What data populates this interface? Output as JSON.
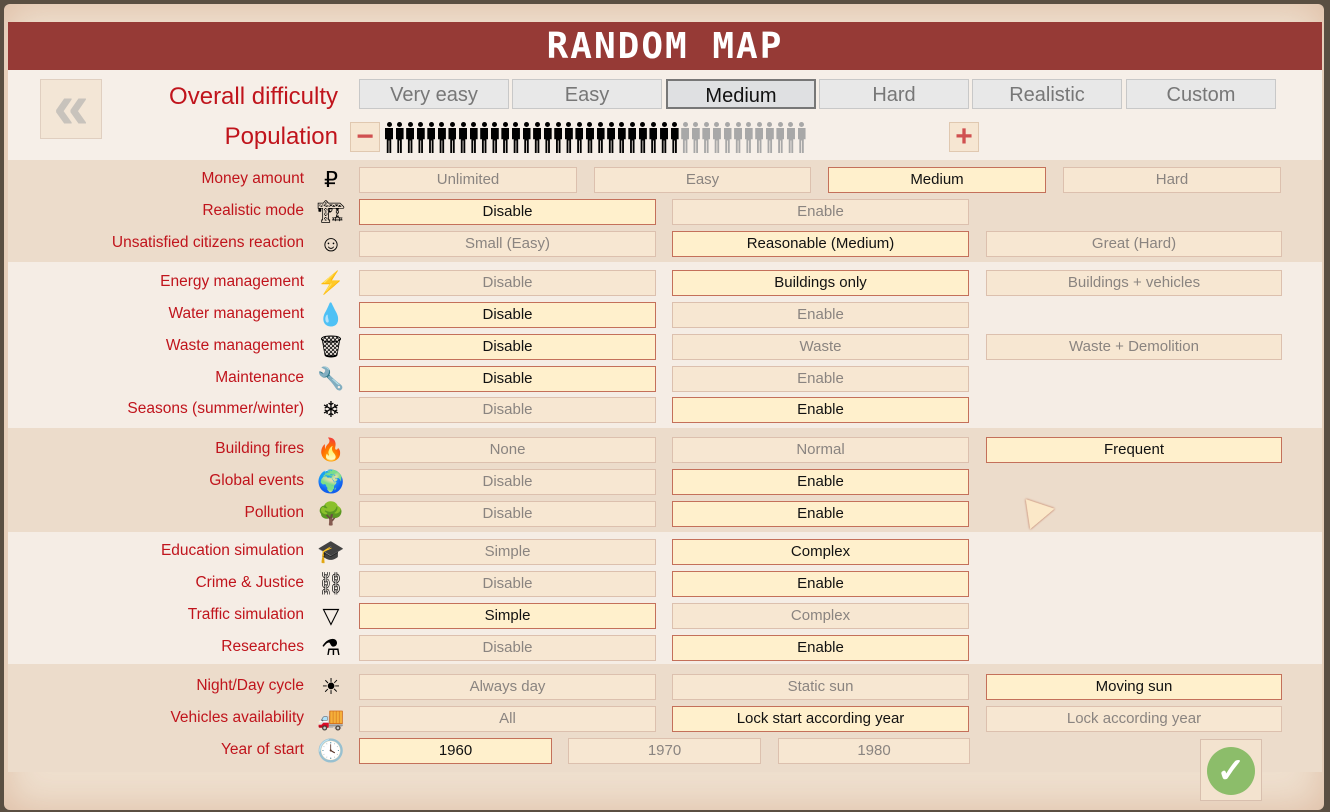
{
  "title": "RANDOM MAP",
  "overall_difficulty": {
    "label": "Overall difficulty",
    "options": [
      "Very easy",
      "Easy",
      "Medium",
      "Hard",
      "Realistic",
      "Custom"
    ],
    "selected": 2
  },
  "population": {
    "label": "Population",
    "level": 0.7,
    "total_figures": 40
  },
  "back_icon": "double-chevron-left-icon",
  "confirm_icon": "checkmark-icon",
  "colors": {
    "title_bar": "#963a36",
    "label": "#c0141c",
    "selected_bg": "#fff0cc",
    "selected_border": "#c4705a",
    "confirm": "#8cbd6a"
  },
  "sections": [
    {
      "rows": [
        {
          "label": "Money amount",
          "icon": "money-icon",
          "glyph": "₽",
          "layout": "four",
          "options": [
            "Unlimited",
            "Easy",
            "Medium",
            "Hard"
          ],
          "selected": 2
        },
        {
          "label": "Realistic mode",
          "icon": "crane-icon",
          "glyph": "🏗",
          "layout": "three",
          "options": [
            "Disable",
            "Enable"
          ],
          "selected": 0
        },
        {
          "label": "Unsatisfied citizens reaction",
          "icon": "smiley-icon",
          "glyph": "☺",
          "layout": "three",
          "options": [
            "Small (Easy)",
            "Reasonable (Medium)",
            "Great (Hard)"
          ],
          "selected": 1
        }
      ]
    },
    {
      "rows": [
        {
          "label": "Energy management",
          "icon": "lightning-icon",
          "glyph": "⚡",
          "layout": "three",
          "options": [
            "Disable",
            "Buildings only",
            "Buildings + vehicles"
          ],
          "selected": 1
        },
        {
          "label": "Water management",
          "icon": "water-drop-icon",
          "glyph": "💧",
          "layout": "three",
          "options": [
            "Disable",
            "Enable"
          ],
          "selected": 0
        },
        {
          "label": "Waste management",
          "icon": "dumpster-icon",
          "glyph": "🗑",
          "layout": "three",
          "options": [
            "Disable",
            "Waste",
            "Waste + Demolition"
          ],
          "selected": 0
        },
        {
          "label": "Maintenance",
          "icon": "wrench-icon",
          "glyph": "🔧",
          "layout": "three",
          "options": [
            "Disable",
            "Enable"
          ],
          "selected": 0
        },
        {
          "label": "Seasons (summer/winter)",
          "icon": "snowflake-icon",
          "glyph": "❄",
          "layout": "three",
          "options": [
            "Disable",
            "Enable"
          ],
          "selected": 1
        }
      ]
    },
    {
      "rows": [
        {
          "label": "Building fires",
          "icon": "fire-icon",
          "glyph": "🔥",
          "layout": "three",
          "options": [
            "None",
            "Normal",
            "Frequent"
          ],
          "selected": 2
        },
        {
          "label": "Global events",
          "icon": "globe-icon",
          "glyph": "🌍",
          "layout": "three",
          "options": [
            "Disable",
            "Enable"
          ],
          "selected": 1
        },
        {
          "label": "Pollution",
          "icon": "dead-tree-icon",
          "glyph": "🌳",
          "layout": "three",
          "options": [
            "Disable",
            "Enable"
          ],
          "selected": 1
        }
      ]
    },
    {
      "rows": [
        {
          "label": "Education simulation",
          "icon": "graduation-cap-icon",
          "glyph": "🎓",
          "layout": "three",
          "options": [
            "Simple",
            "Complex"
          ],
          "selected": 1
        },
        {
          "label": "Crime & Justice",
          "icon": "handcuffs-icon",
          "glyph": "⛓",
          "layout": "three",
          "options": [
            "Disable",
            "Enable"
          ],
          "selected": 1
        },
        {
          "label": "Traffic simulation",
          "icon": "traffic-sign-icon",
          "glyph": "▽",
          "layout": "three",
          "options": [
            "Simple",
            "Complex"
          ],
          "selected": 0
        },
        {
          "label": "Researches",
          "icon": "flask-icon",
          "glyph": "⚗",
          "layout": "three",
          "options": [
            "Disable",
            "Enable"
          ],
          "selected": 1
        }
      ]
    },
    {
      "rows": [
        {
          "label": "Night/Day cycle",
          "icon": "sun-icon",
          "glyph": "☀",
          "layout": "three",
          "options": [
            "Always day",
            "Static sun",
            "Moving sun"
          ],
          "selected": 2
        },
        {
          "label": "Vehicles availability",
          "icon": "truck-icon",
          "glyph": "🚚",
          "layout": "three",
          "options": [
            "All",
            "Lock start according year",
            "Lock according year"
          ],
          "selected": 1
        },
        {
          "label": "Year of start",
          "icon": "clock-icon",
          "glyph": "🕓",
          "layout": "year",
          "options": [
            "1960",
            "1970",
            "1980"
          ],
          "selected": 0
        }
      ]
    }
  ]
}
